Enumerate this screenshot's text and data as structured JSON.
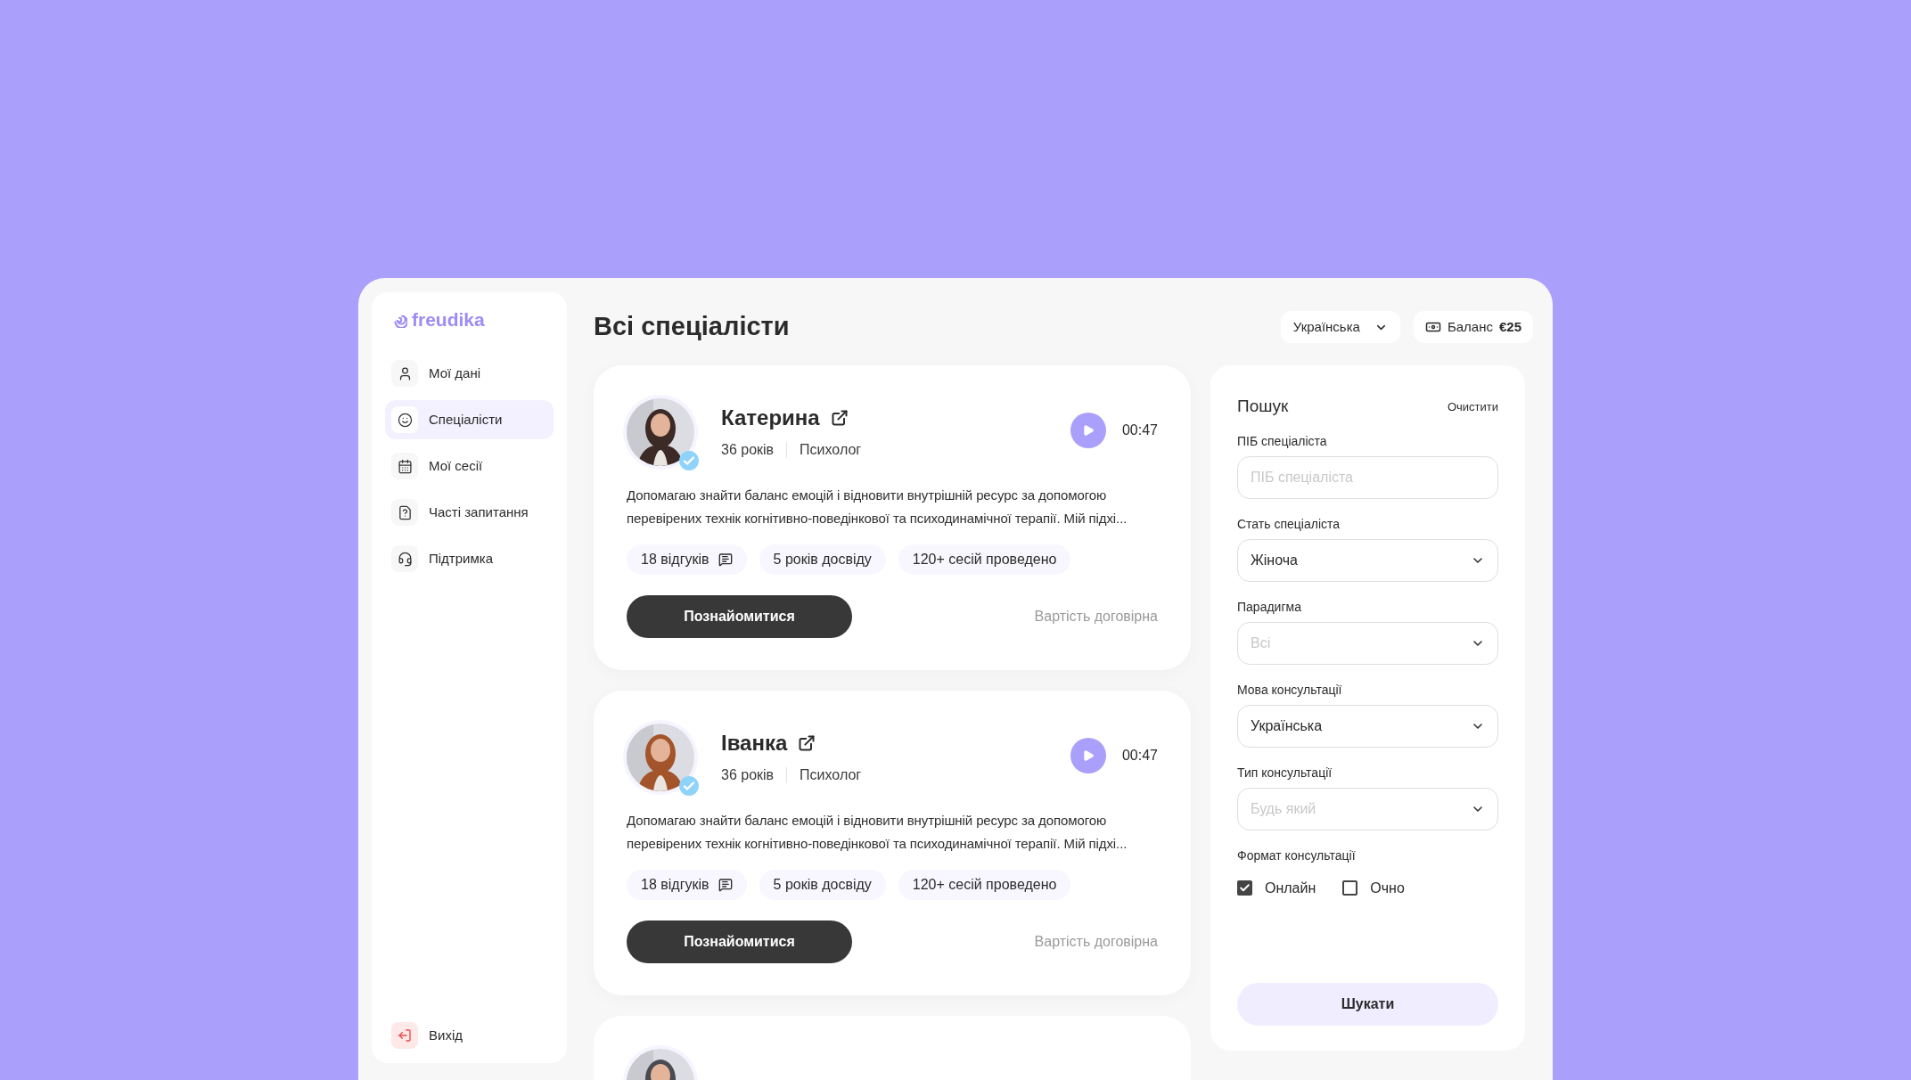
{
  "logo": "freudika",
  "sidebar": {
    "items": [
      {
        "label": "Мої дані",
        "selected": false
      },
      {
        "label": "Спеціалісти",
        "selected": true
      },
      {
        "label": "Мої сесії",
        "selected": false
      },
      {
        "label": "Часті запитання",
        "selected": false
      },
      {
        "label": "Підтримка",
        "selected": false
      }
    ],
    "logout": "Вихід"
  },
  "header": {
    "title": "Всі спеціалісти",
    "language": "Українська",
    "balance_label": "Баланс",
    "balance": "€25"
  },
  "specialists": [
    {
      "name": "Катерина",
      "age": "36 років",
      "role": "Психолог",
      "verified": true,
      "audio": "00:47",
      "bio": "Допомагаю знайти баланс емоцій і відновити внутрішній ресурс за допомогою перевірених технік когнітивно-поведінкової та психодинамічної терапії. Мій підхі...",
      "tags": [
        {
          "text": "18 відгуків",
          "kind": "reviews"
        },
        {
          "text": "5 років досвіду",
          "kind": "plain"
        },
        {
          "text": "120+ сесій проведено",
          "kind": "plain"
        }
      ],
      "button": "Познайомитися",
      "price": "Вартість договірна"
    },
    {
      "name": "Іванка",
      "age": "36 років",
      "role": "Психолог",
      "verified": true,
      "audio": "00:47",
      "bio": "Допомагаю знайти баланс емоцій і відновити внутрішній ресурс за допомогою перевірених технік когнітивно-поведінкової та психодинамічної терапії. Мій підхі...",
      "tags": [
        {
          "text": "18 відгуків",
          "kind": "reviews"
        },
        {
          "text": "5 років досвіду",
          "kind": "plain"
        },
        {
          "text": "120+ сесій проведено",
          "kind": "plain"
        }
      ],
      "button": "Познайомитися",
      "price": "Вартість договірна"
    }
  ],
  "search": {
    "title": "Пошук",
    "clear": "Очистити",
    "fields": [
      {
        "kind": "text",
        "label": "ПІБ спеціаліста",
        "placeholder": "ПІБ спеціаліста"
      },
      {
        "kind": "select",
        "label": "Стать спеціаліста",
        "value": "Жіноча"
      },
      {
        "kind": "select",
        "label": "Парадигма",
        "placeholder": "Всі"
      },
      {
        "kind": "select",
        "label": "Мова консультації",
        "value": "Українська"
      },
      {
        "kind": "select",
        "label": "Тип консультації",
        "placeholder": "Будь який"
      },
      {
        "kind": "checkboxes",
        "label": "Формат консультації",
        "options": [
          {
            "label": "Онлайн",
            "checked": true
          },
          {
            "label": "Очно",
            "checked": false
          }
        ]
      }
    ],
    "button": "Шукати"
  }
}
